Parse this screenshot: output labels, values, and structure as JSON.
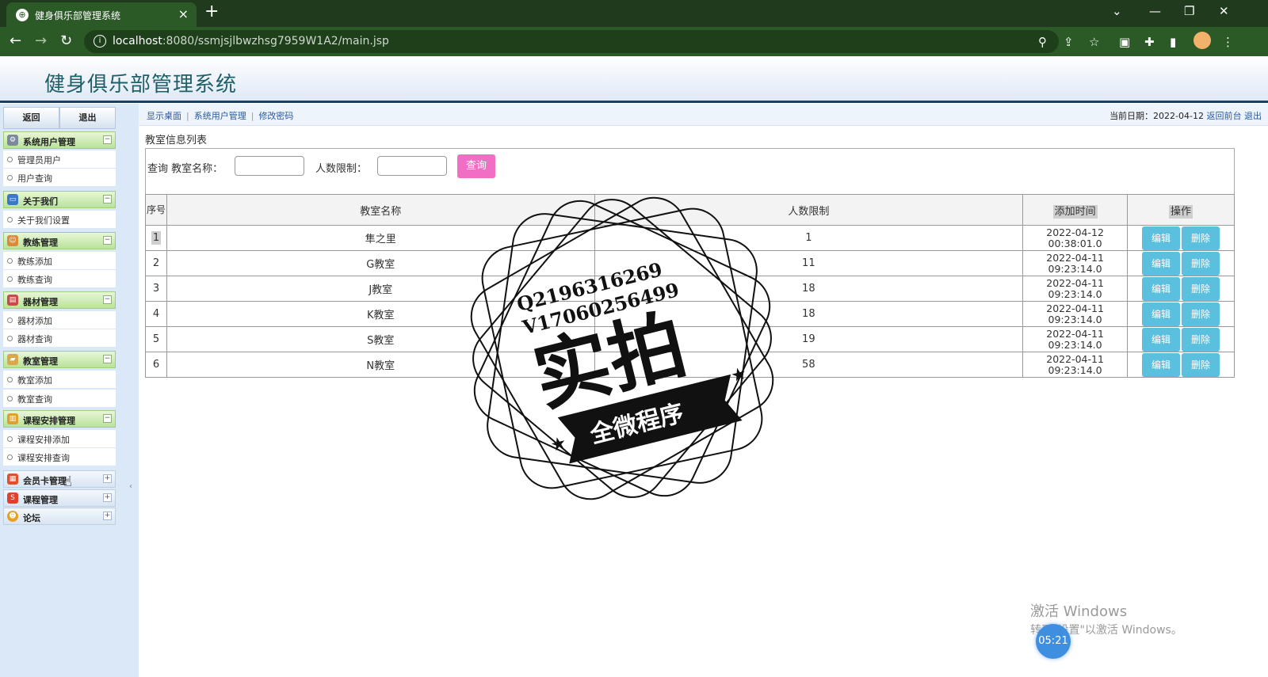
{
  "browser": {
    "tab_title": "健身俱乐部管理系统",
    "url_host": "localhost",
    "url_rest": ":8080/ssmjsjlbwzhsg7959W1A2/main.jsp"
  },
  "app": {
    "title": "健身俱乐部管理系统"
  },
  "sidebar": {
    "back_label": "返回",
    "logout_label": "退出",
    "groups": [
      {
        "label": "系统用户管理",
        "items": [
          "管理员用户",
          "用户查询"
        ]
      },
      {
        "label": "关于我们",
        "items": [
          "关于我们设置"
        ]
      },
      {
        "label": "教练管理",
        "items": [
          "教练添加",
          "教练查询"
        ]
      },
      {
        "label": "器材管理",
        "items": [
          "器材添加",
          "器材查询"
        ]
      },
      {
        "label": "教室管理",
        "items": [
          "教室添加",
          "教室查询"
        ]
      },
      {
        "label": "课程安排管理",
        "items": [
          "课程安排添加",
          "课程安排查询"
        ]
      },
      {
        "label": "会员卡管理",
        "items": []
      },
      {
        "label": "课程管理",
        "items": []
      },
      {
        "label": "论坛",
        "items": []
      }
    ]
  },
  "topnav": {
    "links": [
      "显示桌面",
      "系统用户管理",
      "修改密码"
    ],
    "date_label": "当前日期：2022-04-12",
    "back_front": "返回前台",
    "logout": "退出"
  },
  "page": {
    "section_title": "教室信息列表",
    "search": {
      "prefix": "查询 教室名称：",
      "limit_label": "人数限制：",
      "button": "查询"
    },
    "table": {
      "headers": [
        "序号",
        "教室名称",
        "人数限制",
        "添加时间",
        "操作"
      ],
      "rows": [
        {
          "no": "1",
          "name": "隼之里",
          "limit": "1",
          "date": "2022-04-12",
          "time": "00:38:01.0"
        },
        {
          "no": "2",
          "name": "G教室",
          "limit": "11",
          "date": "2022-04-11",
          "time": "09:23:14.0"
        },
        {
          "no": "3",
          "name": "J教室",
          "limit": "18",
          "date": "2022-04-11",
          "time": "09:23:14.0"
        },
        {
          "no": "4",
          "name": "K教室",
          "limit": "18",
          "date": "2022-04-11",
          "time": "09:23:14.0"
        },
        {
          "no": "5",
          "name": "S教室",
          "limit": "19",
          "date": "2022-04-11",
          "time": "09:23:14.0"
        },
        {
          "no": "6",
          "name": "N教室",
          "limit": "58",
          "date": "2022-04-11",
          "time": "09:23:14.0"
        }
      ],
      "edit_label": "编辑",
      "delete_label": "删除"
    }
  },
  "watermark": {
    "line1": "Q2196316269",
    "line2": "V17060256499",
    "main": "实拍",
    "banner": "全微程序"
  },
  "os": {
    "activate_line1": "激活 Windows",
    "activate_line2": "转到\"设置\"以激活 Windows。",
    "timer": "05:21"
  }
}
